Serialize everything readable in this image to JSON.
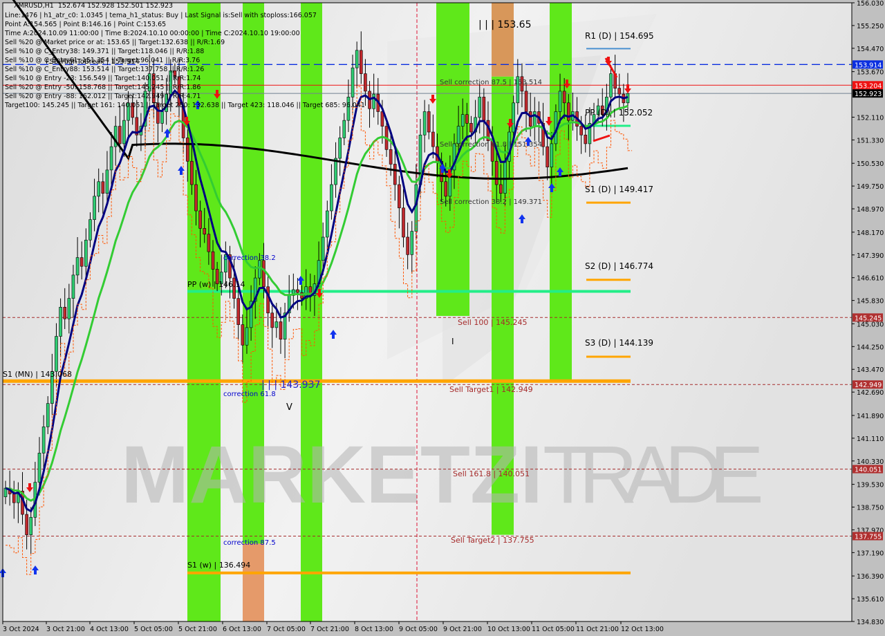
{
  "window": {
    "symbol": "XMRUSD,H1",
    "ohlc": "152.674 152.928 152.501 152.923"
  },
  "info_panel": [
    "Line:1476 | h1_atr_c0: 1.0345 | tema_h1_status: Buy | Last Signal is:Sell with stoploss:166.057",
    "Point A:154.565 | Point B:146.16 | Point C:153.65",
    "Time A:2024.10.09 11:00:00 | Time B:2024.10.10 00:00:00 | Time C:2024.10.10 19:00:00",
    "Sell %20 @ Market price or at: 153.65 || Target:132.638 || R/R:1.69",
    "Sell %10 @ C_Entry38: 149.371 || Target:118.046 || R/R:1.88",
    "Sell %10 @ C_Entry61: 151.354 || Target:96.041 || R/R:3.76",
    "Sell %10 @ C_Entry88: 153.514 || Target:137.758 || R/R:1.26",
    "Sell %10 @ Entry -23: 156.549 || Target:140.051 || R/R:1.74",
    "Sell %20 @ Entry -50: 158.768 || Target:145.245 || R/R:1.86",
    "Sell %20 @ Entry -88: 162.012 || Target:142.949 || R/R:4.71",
    "Target100: 145.245 || Target 161: 140.051 || Target 250: 132.638 || Target 423: 118.046 || Target 685: 96.041"
  ],
  "watermark": {
    "bold": "MARKETZI",
    "light": "TRADE"
  },
  "chart_data": {
    "type": "candlestick",
    "title": "XMRUSD,H1",
    "xlabel": "",
    "ylabel": "",
    "ylim": [
      134.83,
      156.03
    ],
    "grid": false,
    "y_ticks": [
      156.03,
      155.25,
      154.47,
      153.67,
      152.11,
      151.33,
      150.53,
      149.75,
      148.97,
      148.17,
      147.39,
      146.61,
      145.83,
      145.03,
      144.25,
      143.47,
      142.69,
      141.89,
      141.11,
      140.33,
      139.53,
      138.75,
      137.97,
      137.19,
      136.39,
      135.61,
      134.83
    ],
    "x_ticks": [
      "3 Oct 2024",
      "3 Oct 21:00",
      "4 Oct 13:00",
      "5 Oct 05:00",
      "5 Oct 21:00",
      "6 Oct 13:00",
      "7 Oct 05:00",
      "7 Oct 21:00",
      "8 Oct 13:00",
      "9 Oct 05:00",
      "9 Oct 21:00",
      "10 Oct 13:00",
      "11 Oct 05:00",
      "11 Oct 21:00",
      "12 Oct 13:00"
    ],
    "price_badges": [
      {
        "value": "153.914",
        "color": "#0a2ee0",
        "text_color": "#ffffff"
      },
      {
        "value": "153.204",
        "color": "#ee1111",
        "text_color": "#ffffff"
      },
      {
        "value": "152.923",
        "color": "#000000",
        "text_color": "#ffffff"
      },
      {
        "value": "145.245",
        "color": "#b03030",
        "text_color": "#ffffff"
      },
      {
        "value": "142.949",
        "color": "#b03030",
        "text_color": "#ffffff"
      },
      {
        "value": "140.051",
        "color": "#b03030",
        "text_color": "#ffffff"
      },
      {
        "value": "137.755",
        "color": "#b03030",
        "text_color": "#ffffff"
      }
    ],
    "horizontal_levels": [
      {
        "name": "FSB-HighToBreak",
        "price": 153.914,
        "color": "#0a2ee0",
        "style": "dashed",
        "label": "FSB-HighToBreak | 153.914"
      },
      {
        "name": "sell-entry",
        "price": 153.204,
        "color": "#ee1111",
        "style": "solid",
        "label": ""
      },
      {
        "name": "bid",
        "price": 152.923,
        "color": "#708090",
        "style": "solid",
        "label": ""
      },
      {
        "name": "sell-100",
        "price": 145.245,
        "color": "#a52a2a",
        "style": "dotted",
        "label": "Sell 100 | 145.245"
      },
      {
        "name": "sell-target1",
        "price": 142.949,
        "color": "#a52a2a",
        "style": "dotted",
        "label": "Sell Target1 | 142.949"
      },
      {
        "name": "sell-161",
        "price": 140.051,
        "color": "#a52a2a",
        "style": "dotted",
        "label": "Sell 161.8 | 140.051"
      },
      {
        "name": "sell-target2",
        "price": 137.755,
        "color": "#a52a2a",
        "style": "dotted",
        "label": "Sell Target2 | 137.755"
      }
    ],
    "pivot_levels": [
      {
        "label": "R1 (D) | 154.695",
        "price": 154.695,
        "color": "#4a90d0"
      },
      {
        "label": "PP (D) | 152.052",
        "price": 152.052,
        "color": "#22ee88"
      },
      {
        "label": "S1 (D) | 149.417",
        "price": 149.417,
        "color": "#ffa500"
      },
      {
        "label": "S2 (D) | 146.774",
        "price": 146.774,
        "color": "#ffa500"
      },
      {
        "label": "S3 (D) | 144.139",
        "price": 144.139,
        "color": "#ffa500"
      },
      {
        "label": "PP (w) | 146.14",
        "price": 146.14,
        "color": "#22ee88"
      },
      {
        "label": "S1 (w) | 136.494",
        "price": 136.494,
        "color": "#ffa500"
      },
      {
        "label": "S1 (MN) | 143.068",
        "price": 143.068,
        "color": "#ffa500"
      }
    ],
    "annotations": [
      {
        "text": "| | | 153.65",
        "price": 153.65,
        "color": "#000000"
      },
      {
        "text": "| | | 143.937",
        "price": 143.937,
        "color": "#2222cc"
      },
      {
        "text": "Sell correction 87.5 | 153.514",
        "price": 153.514,
        "color": "#333333"
      },
      {
        "text": "Sell correction 61.8 | 151.354",
        "price": 151.354,
        "color": "#333333"
      },
      {
        "text": "Sell correction 38.2 | 149.371",
        "price": 149.371,
        "color": "#333333"
      },
      {
        "text": "correction 38.2",
        "price": 147.3,
        "color": "#0000cc"
      },
      {
        "text": "correction 61.8",
        "price": 142.6,
        "color": "#0000cc"
      },
      {
        "text": "correction 87.5",
        "price": 137.5,
        "color": "#0000cc"
      },
      {
        "text": "V",
        "price": 141.9,
        "color": "#000000"
      },
      {
        "text": "I",
        "price": 144.4,
        "color": "#000000"
      }
    ],
    "series": [
      {
        "name": "close",
        "color": "#000000",
        "values": [
          139.4,
          139.2,
          138.9,
          139.3,
          138.5,
          137.8,
          138.4,
          139.6,
          140.6,
          141.5,
          142.3,
          143.4,
          144.6,
          145.6,
          145.2,
          145.9,
          146.7,
          147.3,
          147.0,
          147.9,
          148.6,
          149.4,
          149.9,
          149.5,
          150.3,
          151.1,
          151.8,
          151.2,
          152.0,
          152.6,
          152.1,
          151.5,
          151.8,
          153.0,
          153.6,
          152.6,
          151.9,
          152.3,
          152.9,
          153.7,
          153.5,
          152.5,
          151.4,
          150.6,
          149.8,
          148.9,
          148.3,
          148.1,
          147.5,
          146.9,
          146.4,
          146.8,
          147.4,
          146.6,
          145.9,
          145.0,
          144.3,
          144.9,
          145.8,
          146.6,
          147.2,
          146.3,
          145.4,
          144.9,
          145.1,
          144.5,
          145.4,
          146.0,
          146.2,
          146.1,
          145.9,
          146.3,
          146.0,
          146.4,
          147.2,
          148.0,
          148.9,
          149.8,
          150.7,
          151.4,
          152.0,
          152.8,
          153.8,
          154.4,
          153.6,
          153.0,
          152.4,
          152.9,
          152.3,
          151.8,
          151.0,
          150.5,
          149.8,
          149.0,
          148.0,
          147.4,
          148.2,
          149.8,
          151.5,
          152.3,
          151.6,
          151.1,
          150.6,
          149.9,
          149.4,
          150.3,
          151.2,
          151.8,
          152.2,
          151.9,
          151.6,
          152.1,
          152.8,
          152.0,
          151.3,
          150.6,
          149.8,
          149.5,
          150.6,
          151.6,
          152.6,
          153.5,
          153.0,
          152.3,
          151.8,
          152.3,
          151.9,
          151.1,
          150.4,
          151.2,
          152.3,
          153.0,
          152.6,
          152.0,
          152.3,
          151.8,
          151.5,
          151.2,
          151.9,
          152.2,
          152.5,
          152.2,
          152.8,
          153.6,
          153.1,
          152.9,
          152.6,
          152.923
        ]
      },
      {
        "name": "TEMA (navy)",
        "color": "#000080"
      },
      {
        "name": "MA (green)",
        "color": "#33cc33"
      },
      {
        "name": "MA 200 (black)",
        "color": "#000000"
      }
    ],
    "vertical_zones": [
      {
        "color": "#5fe81a",
        "span": "5 Oct 21:00"
      },
      {
        "color": "#e59a6a",
        "span": "6 Oct 13:00"
      },
      {
        "color": "#5fe81a",
        "span": "6 Oct 13:00 (upper)"
      },
      {
        "color": "#5fe81a",
        "span": "7 Oct 13:00"
      },
      {
        "color": "#5fe81a",
        "span": "9 Oct 13:00"
      },
      {
        "color": "#d89050",
        "span": "10 Oct 13:00 (top)"
      },
      {
        "color": "#5fe81a",
        "span": "10 Oct 13:00"
      },
      {
        "color": "#5fe81a",
        "span": "11 Oct 05:00"
      }
    ]
  }
}
